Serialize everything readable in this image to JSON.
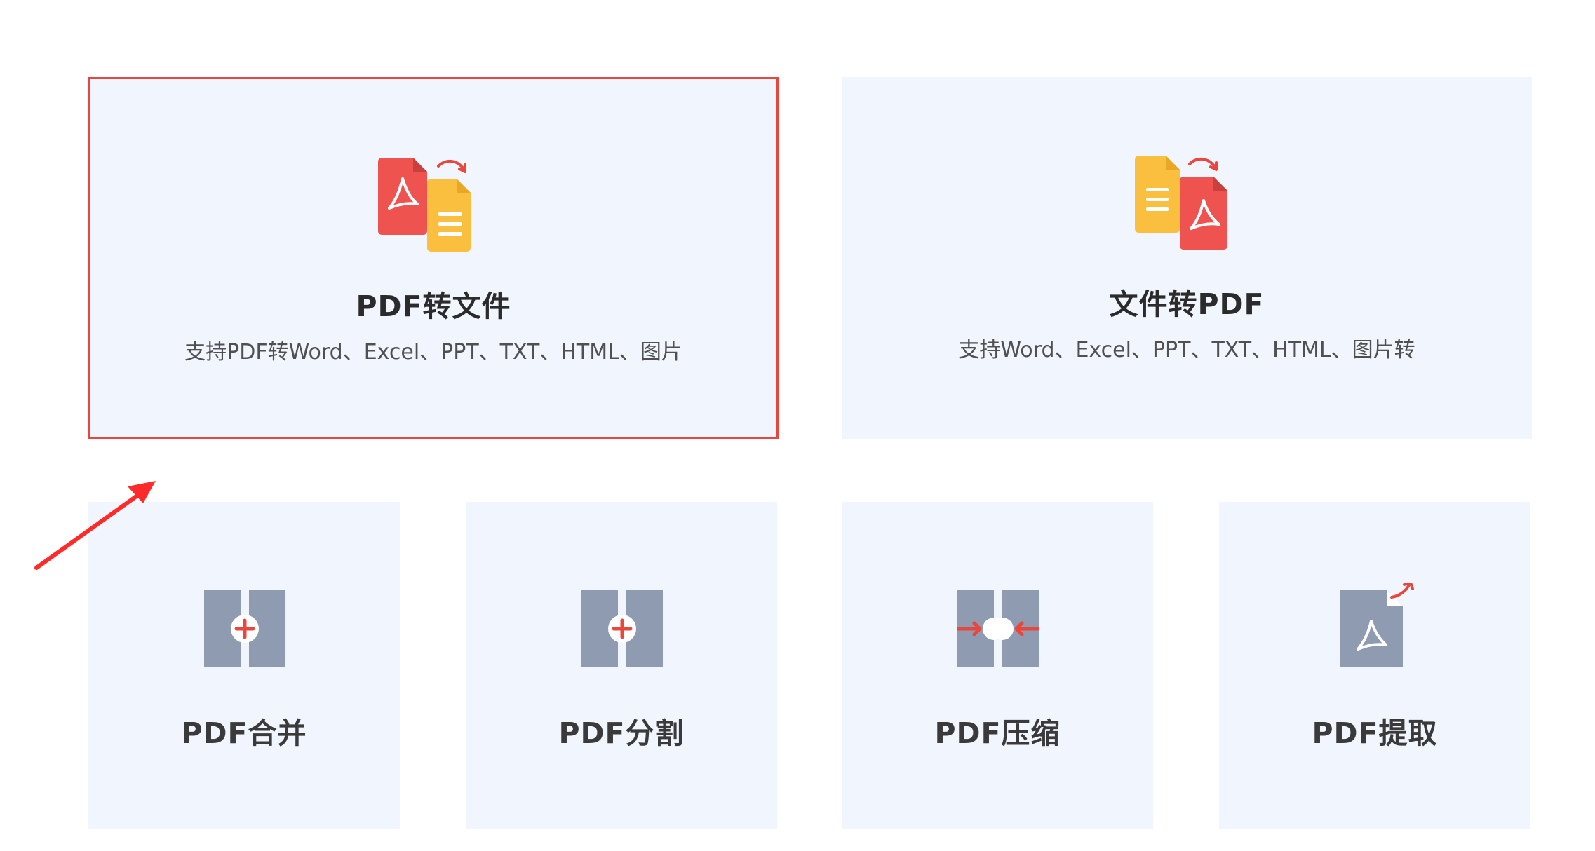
{
  "cards_top": [
    {
      "title": "PDF转文件",
      "desc": "支持PDF转Word、Excel、PPT、TXT、HTML、图片",
      "selected": true
    },
    {
      "title": "文件转PDF",
      "desc": "支持Word、Excel、PPT、TXT、HTML、图片转",
      "selected": false
    }
  ],
  "cards_bottom": [
    {
      "title": "PDF合并",
      "icon": "merge-icon"
    },
    {
      "title": "PDF分割",
      "icon": "split-icon"
    },
    {
      "title": "PDF压缩",
      "icon": "compress-icon"
    },
    {
      "title": "PDF提取",
      "icon": "extract-icon"
    }
  ],
  "colors": {
    "card_bg": "#f1f5fd",
    "selected_border": "#e8473f",
    "pdf_red": "#ef5350",
    "doc_yellow": "#fbbf3f",
    "icon_gray": "#8e9bb0",
    "accent_red": "#e8473f"
  }
}
